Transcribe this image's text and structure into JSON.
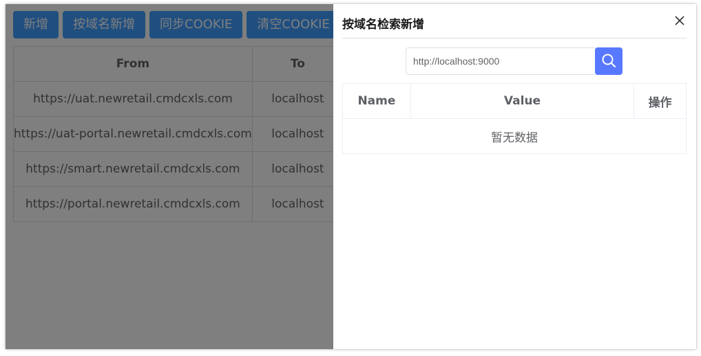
{
  "toolbar": {
    "buttons": [
      "新增",
      "按域名新增",
      "同步COOKIE",
      "清空COOKIE"
    ]
  },
  "main_table": {
    "headers": [
      "From",
      "To"
    ],
    "rows": [
      [
        "https://uat.newretail.cmdcxls.com",
        "localhost"
      ],
      [
        "https://uat-portal.newretail.cmdcxls.com",
        "localhost"
      ],
      [
        "https://smart.newretail.cmdcxls.com",
        "localhost"
      ],
      [
        "https://portal.newretail.cmdcxls.com",
        "localhost"
      ]
    ]
  },
  "drawer": {
    "title": "按域名检索新增",
    "close_icon": "close-icon",
    "search": {
      "value": "http://localhost:9000",
      "button_icon": "search-icon"
    },
    "table": {
      "headers": [
        "Name",
        "Value",
        "操作"
      ],
      "empty_text": "暂无数据"
    }
  },
  "colors": {
    "primary_button": "#409eff",
    "search_button": "#5879ff",
    "overlay": "rgba(0,0,0,0.5)"
  }
}
